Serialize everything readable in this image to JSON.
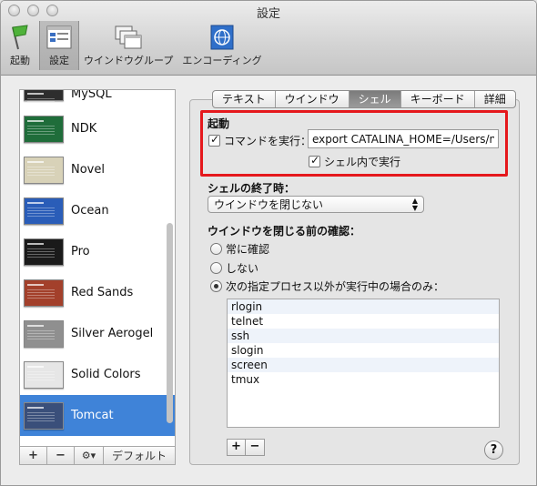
{
  "window": {
    "title": "設定"
  },
  "toolbar": {
    "items": [
      {
        "label": "起動",
        "icon": "flag-icon"
      },
      {
        "label": "設定",
        "icon": "settings-window-icon",
        "selected": true
      },
      {
        "label": "ウインドウグループ",
        "icon": "window-group-icon"
      },
      {
        "label": "エンコーディング",
        "icon": "encoding-globe-icon"
      }
    ]
  },
  "sidebar": {
    "profiles": [
      {
        "name": "MySQL",
        "color": "#2d2d2d"
      },
      {
        "name": "NDK",
        "color": "#1f6d3a"
      },
      {
        "name": "Novel",
        "color": "#d8d2b8"
      },
      {
        "name": "Ocean",
        "color": "#2a5db8"
      },
      {
        "name": "Pro",
        "color": "#1a1a1a"
      },
      {
        "name": "Red Sands",
        "color": "#a3402b"
      },
      {
        "name": "Silver Aerogel",
        "color": "#8f8f8f"
      },
      {
        "name": "Solid Colors",
        "color": "#e6e6e6"
      },
      {
        "name": "Tomcat",
        "color": "#3a4f7a",
        "selected": true
      }
    ],
    "footer": {
      "add": "+",
      "remove": "−",
      "gear": "⚙▾",
      "default": "デフォルト"
    }
  },
  "tabs": [
    "テキスト",
    "ウインドウ",
    "シェル",
    "キーボード",
    "詳細"
  ],
  "active_tab": "シェル",
  "startup": {
    "label": "起動",
    "run_command_label": "コマンドを実行：",
    "run_command_checked": true,
    "command_value": "export CATALINA_HOME=/Users/noni",
    "run_in_shell_label": "シェル内で実行",
    "run_in_shell_checked": true
  },
  "shell_exit": {
    "label": "シェルの終了時：",
    "selected_option": "ウインドウを閉じない"
  },
  "close_confirm": {
    "label": "ウインドウを閉じる前の確認：",
    "options": [
      {
        "label": "常に確認",
        "selected": false
      },
      {
        "label": "しない",
        "selected": false
      },
      {
        "label": "次の指定プロセス以外が実行中の場合のみ：",
        "selected": true
      }
    ],
    "processes": [
      "rlogin",
      "telnet",
      "ssh",
      "slogin",
      "screen",
      "tmux"
    ],
    "add": "+",
    "remove": "−"
  },
  "help": "?",
  "colors": {
    "selection": "#3f83d8",
    "highlight_box": "#e5181c"
  }
}
